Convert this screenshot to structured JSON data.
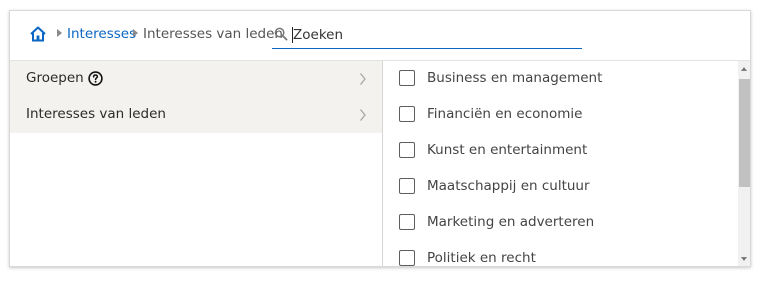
{
  "breadcrumb": {
    "home_icon": "home-icon",
    "items": [
      {
        "label": "Interesses"
      },
      {
        "label": "Interesses van leden"
      }
    ]
  },
  "search": {
    "placeholder": "Zoeken",
    "value": ""
  },
  "categories": [
    {
      "label": "Groepen",
      "has_help": true,
      "help_icon": "help-circle-icon"
    },
    {
      "label": "Interesses van leden",
      "has_help": false
    }
  ],
  "options": [
    {
      "label": "Business en management",
      "checked": false
    },
    {
      "label": "Financiën en economie",
      "checked": false
    },
    {
      "label": "Kunst en entertainment",
      "checked": false
    },
    {
      "label": "Maatschappij en cultuur",
      "checked": false
    },
    {
      "label": "Marketing en adverteren",
      "checked": false
    },
    {
      "label": "Politiek en recht",
      "checked": false
    }
  ],
  "colors": {
    "accent": "#0a66c2",
    "selected_row": "#f3f2ef",
    "text": "#333333"
  }
}
